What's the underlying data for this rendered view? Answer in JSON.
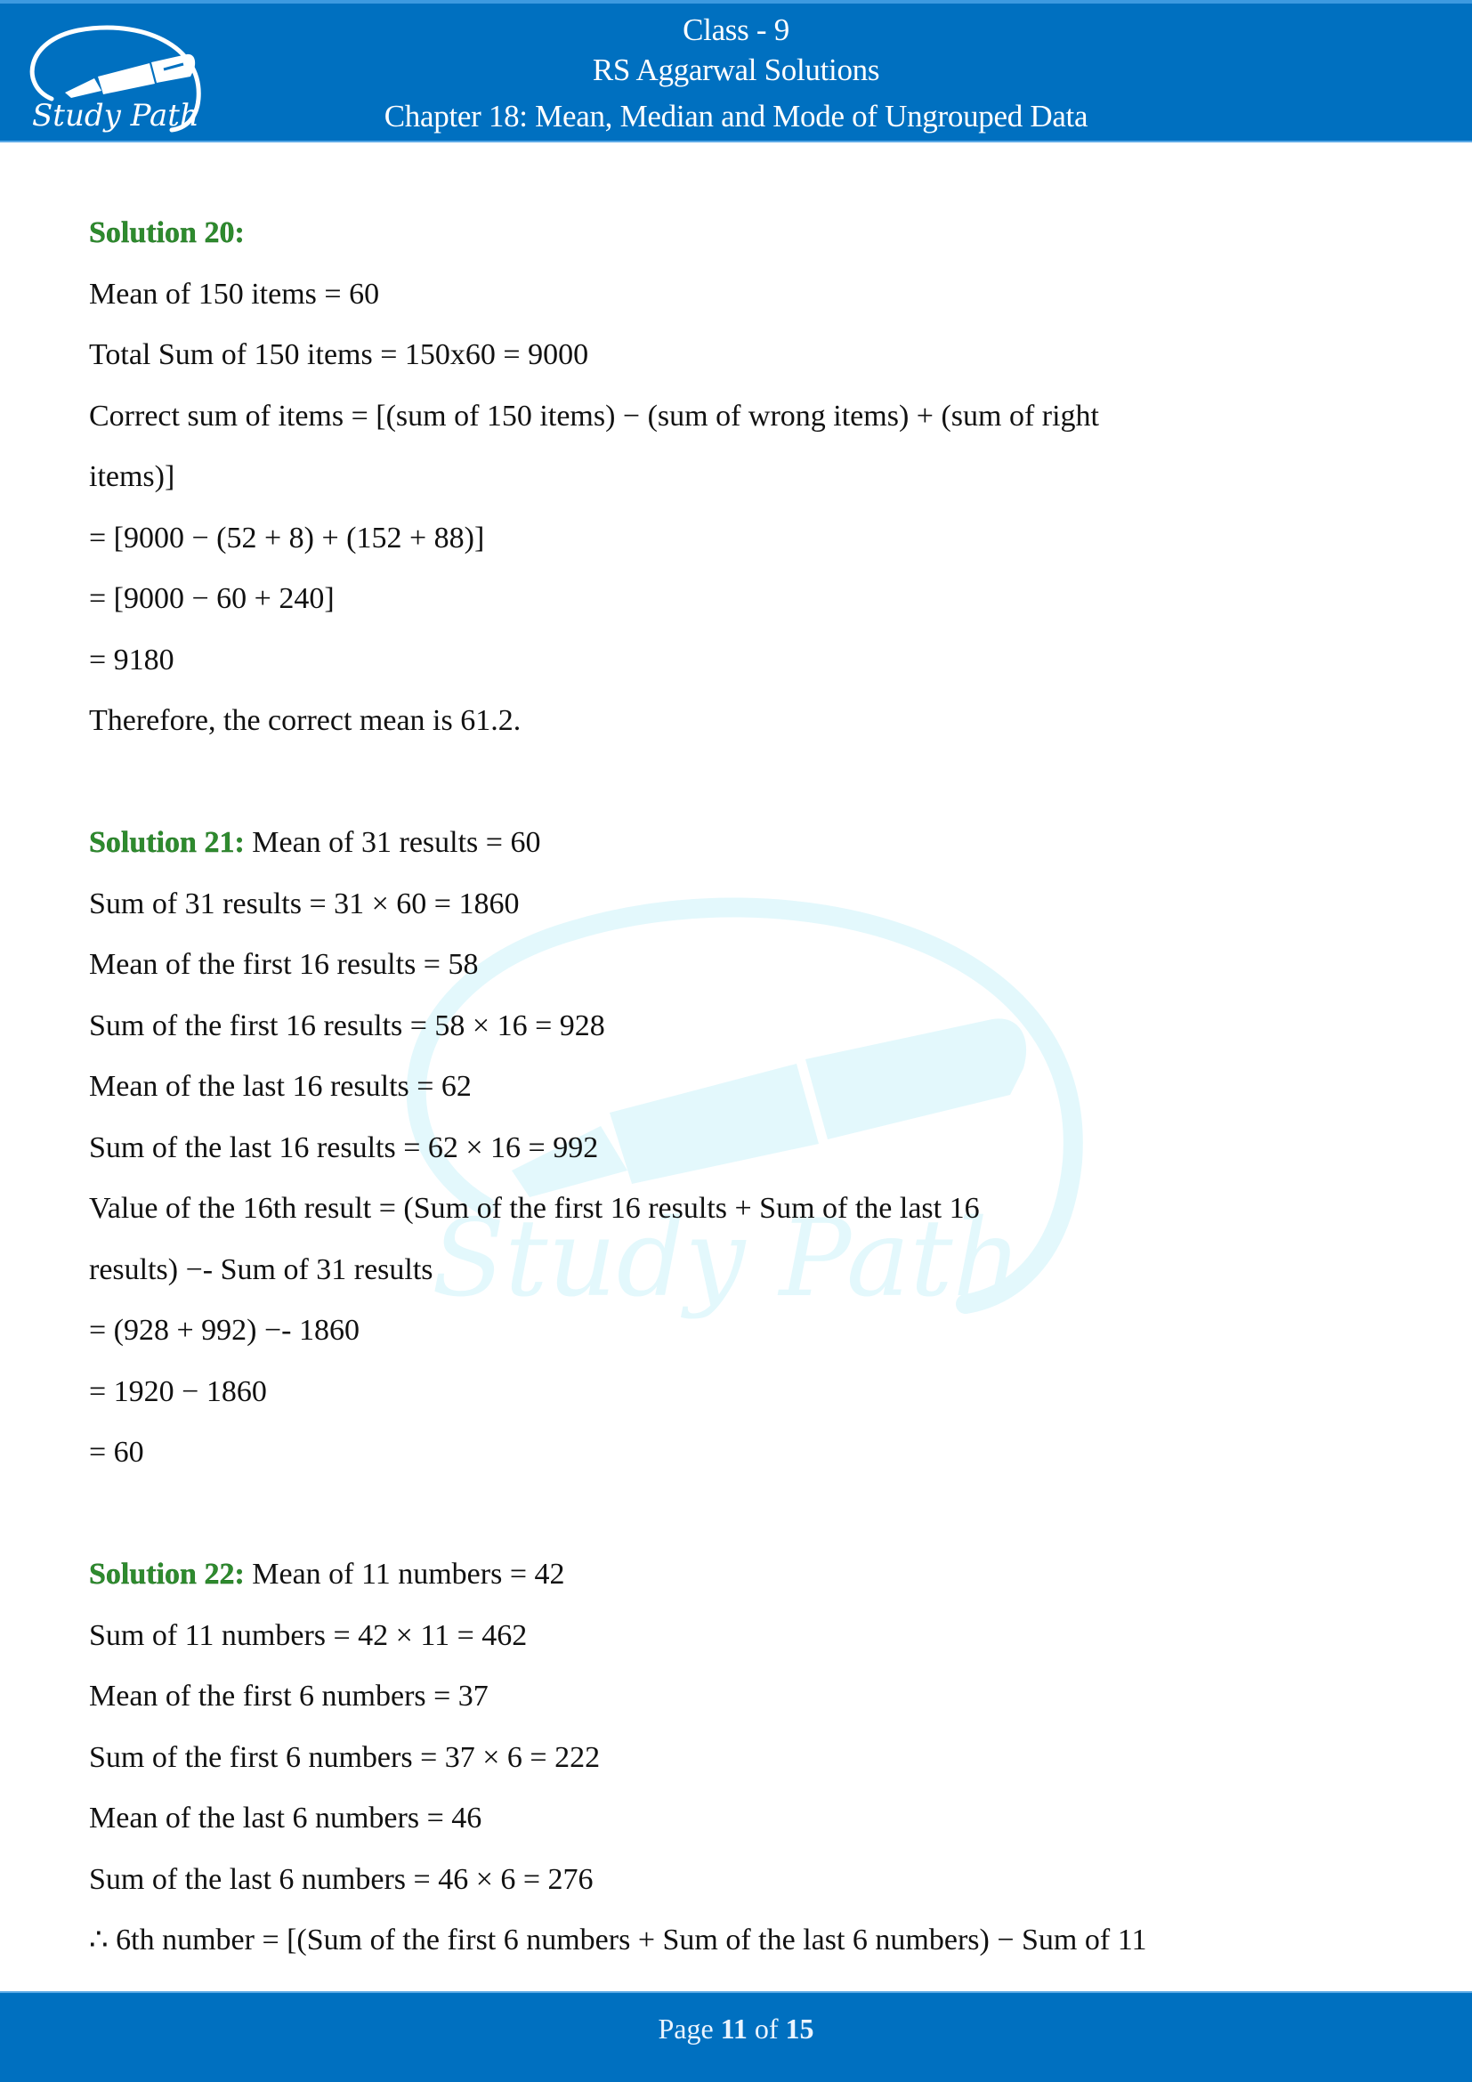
{
  "header": {
    "class_label": "Class - 9",
    "book_title": "RS Aggarwal Solutions",
    "chapter_title": "Chapter 18: Mean, Median and Mode of Ungrouped Data",
    "logo_text": "Study Path",
    "logo_icon": "fountain-pen-icon",
    "background_color": "#0070c0"
  },
  "watermark": {
    "text": "Study Path",
    "color": "#e3f8fc"
  },
  "solutions": [
    {
      "heading": "Solution 20:",
      "first_line_inline": "",
      "lines": [
        "Mean of 150 items = 60",
        "Total Sum of 150 items = 150x60 = 9000",
        "Correct sum of items = [(sum of 150 items) − (sum of wrong items) + (sum of right",
        "items)]",
        "= [9000 − (52 + 8) + (152 + 88)]",
        "= [9000 − 60 + 240]",
        "= 9180",
        "Therefore, the correct mean is 61.2."
      ]
    },
    {
      "heading": "Solution 21:",
      "first_line_inline": " Mean of 31 results = 60",
      "lines": [
        "Sum of 31 results = 31 × 60 = 1860",
        "Mean of the first 16 results = 58",
        "Sum of the first 16 results = 58 × 16 = 928",
        "Mean of the last 16 results = 62",
        "Sum of the last 16 results = 62 × 16 = 992",
        "Value of the 16th result = (Sum of the first 16 results + Sum of the last 16",
        "results) −- Sum of 31 results",
        "= (928 + 992) −- 1860",
        "= 1920 − 1860",
        "= 60"
      ]
    },
    {
      "heading": "Solution 22:",
      "first_line_inline": " Mean of 11 numbers = 42",
      "lines": [
        "Sum of 11 numbers = 42 × 11 = 462",
        "Mean of the first 6 numbers = 37",
        "Sum of the first 6 numbers = 37 × 6 = 222",
        "Mean of the last 6 numbers = 46",
        "Sum of the last 6 numbers = 46 × 6 = 276",
        "∴ 6th number = [(Sum of the first 6 numbers + Sum of the last 6 numbers) − Sum of 11"
      ]
    }
  ],
  "footer": {
    "page_prefix": "Page ",
    "current_page": "11",
    "of_label": " of ",
    "total_pages": "15"
  }
}
